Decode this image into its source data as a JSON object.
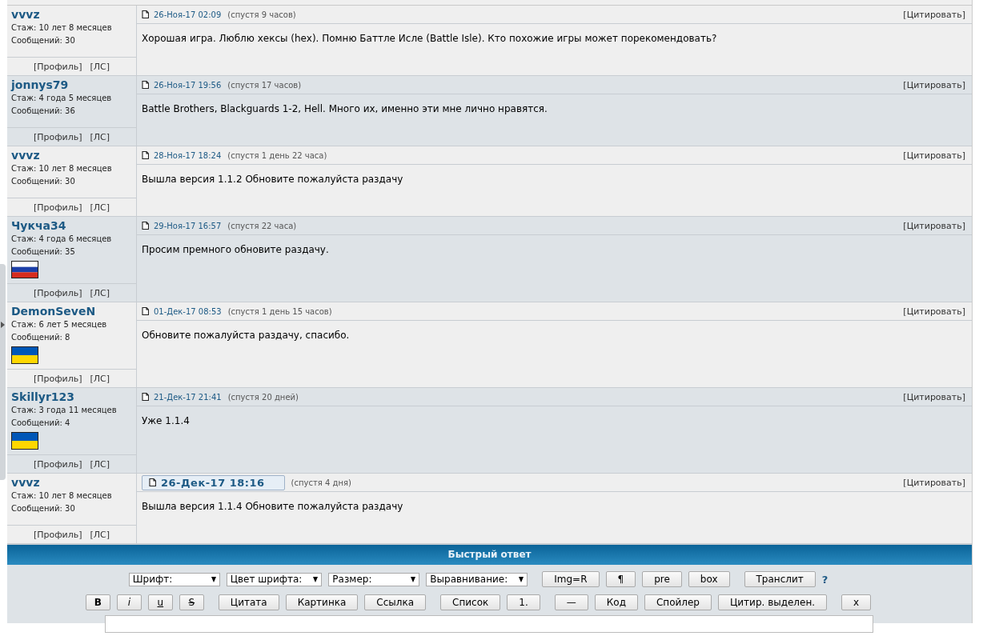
{
  "posts": [
    {
      "author": "vvvz",
      "tenure": "Стаж: 10 лет 8 месяцев",
      "messages": "Сообщений: 30",
      "date": "26-Ноя-17 02:09",
      "current": false,
      "after": "(спустя 9 часов)",
      "quote": "[Цитировать]",
      "text": "Хорошая игра. Люблю хексы (hex). Помню Баттле Исле (Battle Isle). Кто похожие игры может порекомендовать?",
      "profile": "[Профиль]",
      "pm": "[ЛС]"
    },
    {
      "author": "jonnys79",
      "tenure": "Стаж: 4 года 5 месяцев",
      "messages": "Сообщений: 36",
      "date": "26-Ноя-17 19:56",
      "current": false,
      "after": "(спустя 17 часов)",
      "quote": "[Цитировать]",
      "text": "Battle Brothers, Blackguards 1-2, Hell. Много их, именно эти мне лично нравятся.",
      "profile": "[Профиль]",
      "pm": "[ЛС]"
    },
    {
      "author": "vvvz",
      "tenure": "Стаж: 10 лет 8 месяцев",
      "messages": "Сообщений: 30",
      "date": "28-Ноя-17 18:24",
      "current": false,
      "after": "(спустя 1 день 22 часа)",
      "quote": "[Цитировать]",
      "text": "Вышла версия 1.1.2 Обновите пожалуйста раздачу",
      "profile": "[Профиль]",
      "pm": "[ЛС]"
    },
    {
      "author": "Чукча34",
      "tenure": "Стаж: 4 года 6 месяцев",
      "messages": "Сообщений: 35",
      "flag": {
        "kind": "ru"
      },
      "date": "29-Ноя-17 16:57",
      "current": false,
      "after": "(спустя 22 часа)",
      "quote": "[Цитировать]",
      "text": "Просим премного обновите раздачу.",
      "profile": "[Профиль]",
      "pm": "[ЛС]"
    },
    {
      "author": "DemonSeveN",
      "tenure": "Стаж: 6 лет 5 месяцев",
      "messages": "Сообщений: 8",
      "flag": {
        "kind": "ua"
      },
      "date": "01-Дек-17 08:53",
      "current": false,
      "after": "(спустя 1 день 15 часов)",
      "quote": "[Цитировать]",
      "text": "Обновите пожалуйста раздачу, спасибо.",
      "profile": "[Профиль]",
      "pm": "[ЛС]"
    },
    {
      "author": "Skillyr123",
      "tenure": "Стаж: 3 года 11 месяцев",
      "messages": "Сообщений: 4",
      "flag": {
        "kind": "ua"
      },
      "date": "21-Дек-17 21:41",
      "current": false,
      "after": "(спустя 20 дней)",
      "quote": "[Цитировать]",
      "text": "Уже 1.1.4",
      "profile": "[Профиль]",
      "pm": "[ЛС]"
    },
    {
      "author": "vvvz",
      "tenure": "Стаж: 10 лет 8 месяцев",
      "messages": "Сообщений: 30",
      "date": "26-Дек-17 18:16",
      "current": true,
      "after": "(спустя 4 дня)",
      "quote": "[Цитировать]",
      "text": "Вышла версия 1.1.4 Обновите пожалуйста раздачу",
      "profile": "[Профиль]",
      "pm": "[ЛС]"
    }
  ],
  "quick_reply": {
    "title": "Быстрый ответ",
    "toolbar_rows": [
      [
        [
          {
            "kind": "select",
            "label": "Шрифт:"
          },
          {
            "kind": "select",
            "label": "Цвет шрифта:"
          },
          {
            "kind": "select",
            "label": "Размер:"
          },
          {
            "kind": "select",
            "label": "Выравнивание:"
          }
        ],
        [
          {
            "kind": "button",
            "label": "Img=R"
          },
          {
            "kind": "button",
            "label": "¶"
          },
          {
            "kind": "button",
            "label": "pre"
          },
          {
            "kind": "button",
            "label": "box"
          }
        ],
        [
          {
            "kind": "button",
            "label": "Транслит"
          },
          {
            "kind": "help",
            "label": "?"
          }
        ]
      ],
      [
        [
          {
            "kind": "bold",
            "label": "B"
          },
          {
            "kind": "italic",
            "label": "i"
          },
          {
            "kind": "underline",
            "label": "u"
          },
          {
            "kind": "strike",
            "label": "S"
          }
        ],
        [
          {
            "kind": "button",
            "label": "Цитата"
          },
          {
            "kind": "button",
            "label": "Картинка"
          },
          {
            "kind": "button",
            "label": "Ссылка"
          }
        ],
        [
          {
            "kind": "button",
            "label": "Список"
          },
          {
            "kind": "button",
            "label": "1."
          }
        ],
        [
          {
            "kind": "button",
            "label": "—"
          },
          {
            "kind": "button",
            "label": "Код"
          },
          {
            "kind": "button",
            "label": "Спойлер"
          },
          {
            "kind": "button",
            "label": "Цитир. выделен."
          }
        ],
        [
          {
            "kind": "button",
            "label": "x"
          }
        ]
      ]
    ]
  }
}
